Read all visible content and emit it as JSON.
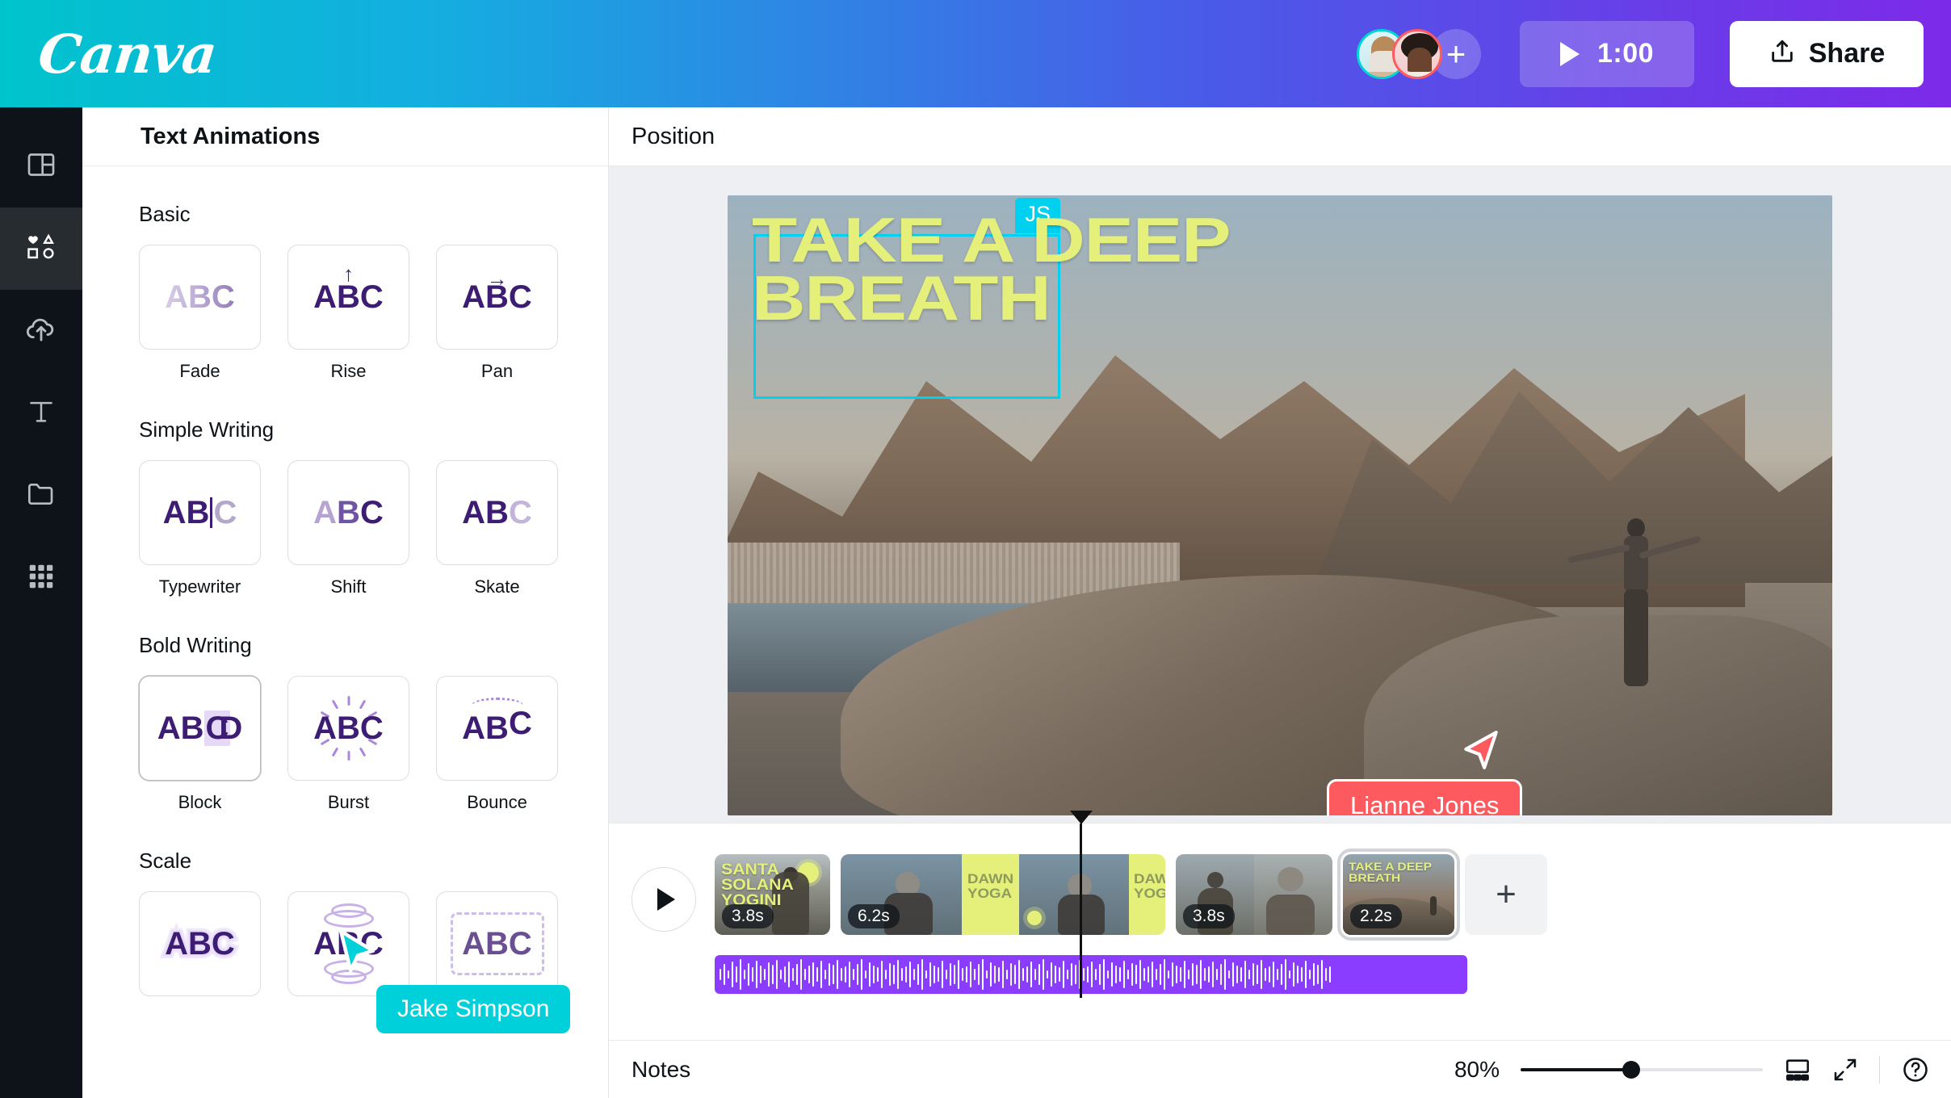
{
  "header": {
    "logo": "Canva",
    "collaborators": [
      {
        "name": "collaborator-1",
        "ring_color": "#00d5d5"
      },
      {
        "name": "collaborator-2",
        "ring_color": "#ff5a5f"
      }
    ],
    "add_collaborator_label": "+",
    "play_time": "1:00",
    "share_label": "Share"
  },
  "rail": {
    "items": [
      {
        "id": "design",
        "icon": "layout-icon",
        "active": false
      },
      {
        "id": "elements",
        "icon": "shapes-icon",
        "active": true
      },
      {
        "id": "uploads",
        "icon": "cloud-upload-icon",
        "active": false
      },
      {
        "id": "text",
        "icon": "text-t-icon",
        "active": false
      },
      {
        "id": "projects",
        "icon": "folder-icon",
        "active": false
      },
      {
        "id": "apps",
        "icon": "grid-apps-icon",
        "active": false
      }
    ]
  },
  "panel": {
    "title": "Text Animations",
    "groups": [
      {
        "title": "Basic",
        "tiles": [
          {
            "label": "Fade",
            "preview": "ABC",
            "style": "fade"
          },
          {
            "label": "Rise",
            "preview": "ABC",
            "style": "rise"
          },
          {
            "label": "Pan",
            "preview": "ABC",
            "style": "pan"
          }
        ]
      },
      {
        "title": "Simple Writing",
        "tiles": [
          {
            "label": "Typewriter",
            "preview": "ABC",
            "style": "typewriter"
          },
          {
            "label": "Shift",
            "preview": "ABC",
            "style": "shift"
          },
          {
            "label": "Skate",
            "preview": "ABC",
            "style": "skate"
          }
        ]
      },
      {
        "title": "Bold Writing",
        "tiles": [
          {
            "label": "Block",
            "preview": "ABC",
            "style": "block"
          },
          {
            "label": "Burst",
            "preview": "ABC",
            "style": "burst"
          },
          {
            "label": "Bounce",
            "preview": "ABC",
            "style": "bounce"
          }
        ]
      },
      {
        "title": "Scale",
        "tiles": [
          {
            "label": "",
            "preview": "ABC",
            "style": "outline"
          },
          {
            "label": "",
            "preview": "ABC",
            "style": "sonar"
          },
          {
            "label": "",
            "preview": "ABC",
            "style": "dashed"
          }
        ]
      }
    ]
  },
  "main": {
    "position_tab": "Position",
    "canvas": {
      "selected_element_badge": "JS",
      "hero_text_line1": "TAKE A DEEP",
      "hero_text_line2": "BREATH",
      "hero_text_color": "#e4f07a",
      "selection_border_color": "#00d0f0",
      "remote_cursor": {
        "name": "Lianne Jones",
        "color": "#fc5a5f"
      }
    }
  },
  "panel_cursor": {
    "name": "Jake Simpson",
    "color": "#00d0d9"
  },
  "timeline": {
    "play_label": "play-scene",
    "clips": [
      {
        "duration": "3.8s",
        "text": "SANTA SOLANA YOGINI",
        "selected": false
      },
      {
        "duration": "6.2s",
        "text": "DAWN YOGA",
        "selected": false
      },
      {
        "duration": "3.8s",
        "text": "",
        "selected": false
      },
      {
        "duration": "2.2s",
        "text": "TAKE A DEEP BREATH",
        "selected": true
      }
    ],
    "add_page_label": "+",
    "audio_track_color": "#8b3dff"
  },
  "bottombar": {
    "notes_label": "Notes",
    "zoom_percent": "80%",
    "grid_view_icon": "grid-view-icon",
    "fullscreen_icon": "expand-icon",
    "help_icon": "help-circle-icon"
  }
}
